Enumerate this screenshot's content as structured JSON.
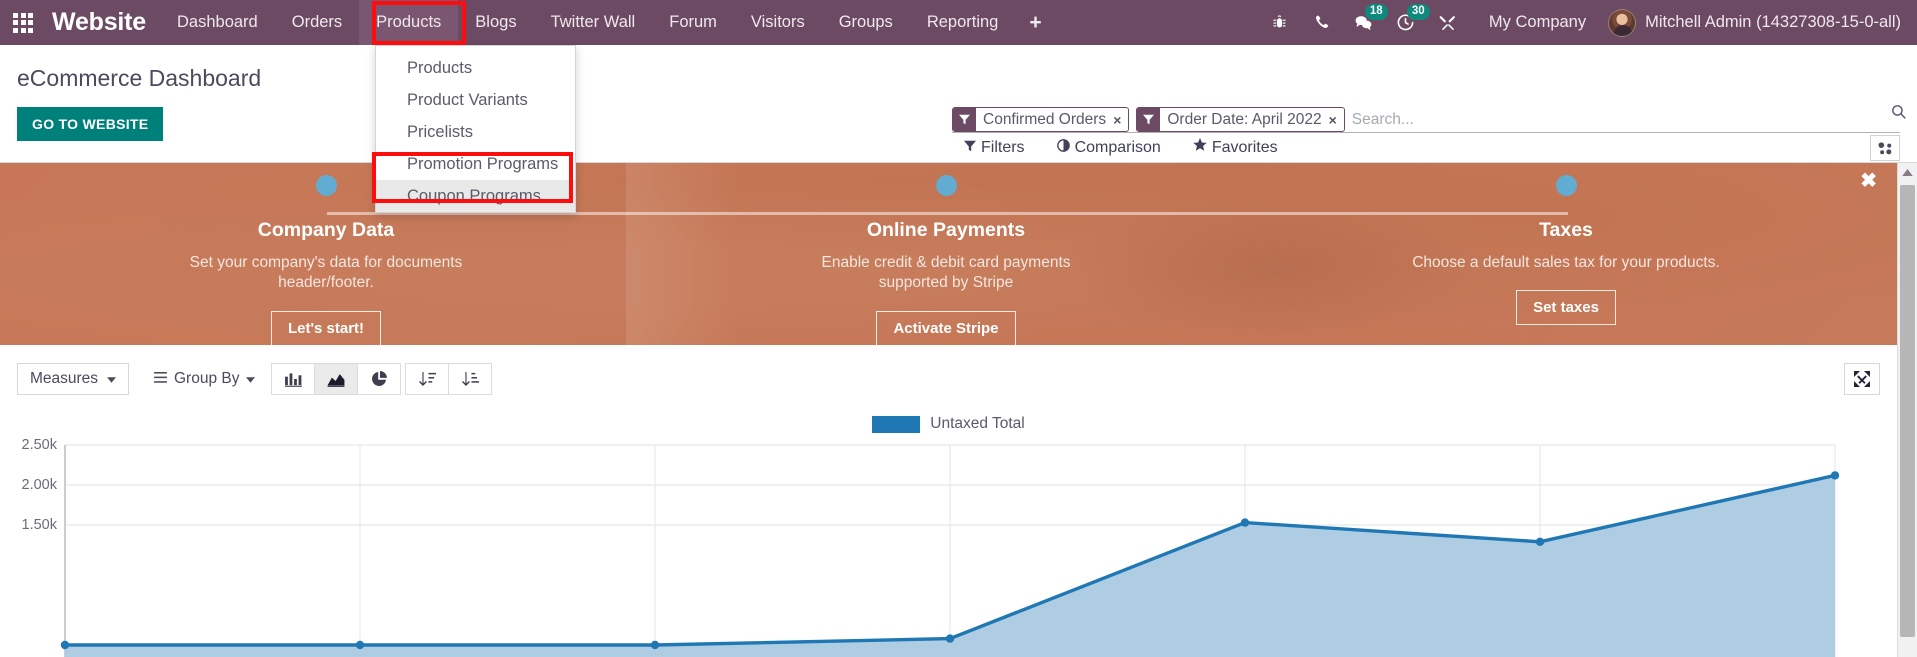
{
  "navbar": {
    "apps_icon": "apps-grid-icon",
    "brand": "Website",
    "menu": [
      {
        "label": "Dashboard",
        "open": false
      },
      {
        "label": "Orders",
        "open": false
      },
      {
        "label": "Products",
        "open": true
      },
      {
        "label": "Blogs",
        "open": false
      },
      {
        "label": "Twitter Wall",
        "open": false
      },
      {
        "label": "Forum",
        "open": false
      },
      {
        "label": "Visitors",
        "open": false
      },
      {
        "label": "Groups",
        "open": false
      },
      {
        "label": "Reporting",
        "open": false
      }
    ],
    "plus_label": "+",
    "systray": [
      {
        "name": "bug-icon",
        "badge": ""
      },
      {
        "name": "phone-icon",
        "badge": ""
      },
      {
        "name": "messages-icon",
        "badge": "18"
      },
      {
        "name": "activities-clock-icon",
        "badge": "30"
      },
      {
        "name": "tools-icon",
        "badge": ""
      }
    ],
    "company": "My Company",
    "user": "Mitchell Admin (14327308-15-0-all)",
    "brand_color": "#6d4a63",
    "badge_color": "#0e8a7d"
  },
  "dropdown": {
    "items": [
      {
        "label": "Products",
        "hover": false
      },
      {
        "label": "Product Variants",
        "hover": false
      },
      {
        "label": "Pricelists",
        "hover": false
      },
      {
        "label": "Promotion Programs",
        "hover": false
      },
      {
        "label": "Coupon Programs",
        "hover": true
      }
    ],
    "highlight_color": "#fd0d0d"
  },
  "control_panel": {
    "title": "eCommerce Dashboard",
    "website_button": "GO TO WEBSITE",
    "website_button_color": "#00807a",
    "facets": [
      {
        "icon": "filter-icon",
        "label": "Confirmed Orders",
        "remove": "×"
      },
      {
        "icon": "filter-icon",
        "label": "Order Date: April 2022",
        "remove": "×"
      }
    ],
    "search_placeholder": "Search...",
    "search_value": "",
    "search_icon": "search-icon",
    "links": [
      {
        "icon": "filter-icon",
        "label": "Filters"
      },
      {
        "icon": "comparison-icon",
        "label": "Comparison"
      },
      {
        "icon": "star-icon",
        "label": "Favorites"
      }
    ],
    "view_switcher_icon": "graph-view-icon"
  },
  "banner": {
    "close_icon": "close-icon",
    "steps": [
      {
        "title": "Company Data",
        "description": "Set your company's data for documents header/footer.",
        "button": "Let's start!"
      },
      {
        "title": "Online Payments",
        "description": "Enable credit & debit card payments supported by Stripe",
        "button": "Activate Stripe"
      },
      {
        "title": "Taxes",
        "description": "Choose a default sales tax for your products.",
        "button": "Set taxes"
      }
    ],
    "dot_color": "#62acd2"
  },
  "graph": {
    "measures_button": "Measures",
    "groupby_button": "Group By",
    "chart_buttons": [
      {
        "name": "bar-chart-icon",
        "active": false
      },
      {
        "name": "area-chart-icon",
        "active": true
      },
      {
        "name": "pie-chart-icon",
        "active": false
      }
    ],
    "sort_buttons": [
      {
        "name": "sort-descending-icon",
        "active": false
      },
      {
        "name": "sort-ascending-icon",
        "active": false
      }
    ],
    "expand_icon": "expand-icon"
  },
  "chart_data": {
    "type": "area",
    "title": "",
    "xlabel": "",
    "ylabel": "",
    "legend": [
      "Untaxed Total"
    ],
    "legend_position": "top-center",
    "series_color": "#1f77b4",
    "fill_color": "#aecde3",
    "grid": true,
    "ylim": [
      0,
      2500
    ],
    "yticks": [
      2500,
      2000,
      1500
    ],
    "ytick_labels": [
      "2.50k",
      "2.00k",
      "1.50k"
    ],
    "x": [
      1,
      2,
      3,
      4,
      5,
      6,
      7
    ],
    "categories": [
      "",
      "",
      "",
      "",
      "",
      "",
      ""
    ],
    "series": [
      {
        "name": "Untaxed Total",
        "values": [
          0,
          0,
          0,
          80,
          1530,
          1290,
          2120
        ]
      }
    ],
    "visible_note": "chart is clipped by the bottom of the viewport"
  },
  "scrollbar": {
    "up_arrow_icon": "scroll-up-icon",
    "thumb": "scroll-thumb"
  }
}
